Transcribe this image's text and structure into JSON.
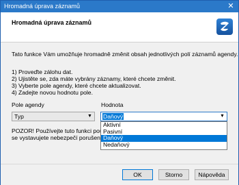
{
  "window": {
    "title": "Hromadná úprava záznamů",
    "close_glyph": "✕"
  },
  "header": {
    "heading": "Hromadná úprava záznamů",
    "logo_icon": "app-logo-icon",
    "logo_color": "#2274c8"
  },
  "intro": "Tato funkce Vám umožňuje hromadně změnit obsah jednotlivých polí záznamů agendy.",
  "steps": [
    "1) Proveďte zálohu dat.",
    "2) Ujistěte se, zda máte vybrány záznamy, které chcete změnit.",
    "3) Vyberte pole agendy, které chcete aktualizovat.",
    "4) Zadejte novou hodnotu pole."
  ],
  "fields": {
    "pole_label": "Pole agendy",
    "pole_value": "Typ",
    "hodnota_label": "Hodnota",
    "hodnota_value": "Daňový"
  },
  "dropdown_options": [
    {
      "label": "Aktivní",
      "selected": false
    },
    {
      "label": "Pasivní",
      "selected": false
    },
    {
      "label": "Daňový",
      "selected": true
    },
    {
      "label": "Nedaňový",
      "selected": false
    }
  ],
  "warning": {
    "line1": "POZOR! Používejte tuto funkci pouze",
    "line2": "se vystavujete nebezpečí porušení úd"
  },
  "buttons": {
    "ok": "OK",
    "cancel": "Storno",
    "help": "Nápověda"
  }
}
